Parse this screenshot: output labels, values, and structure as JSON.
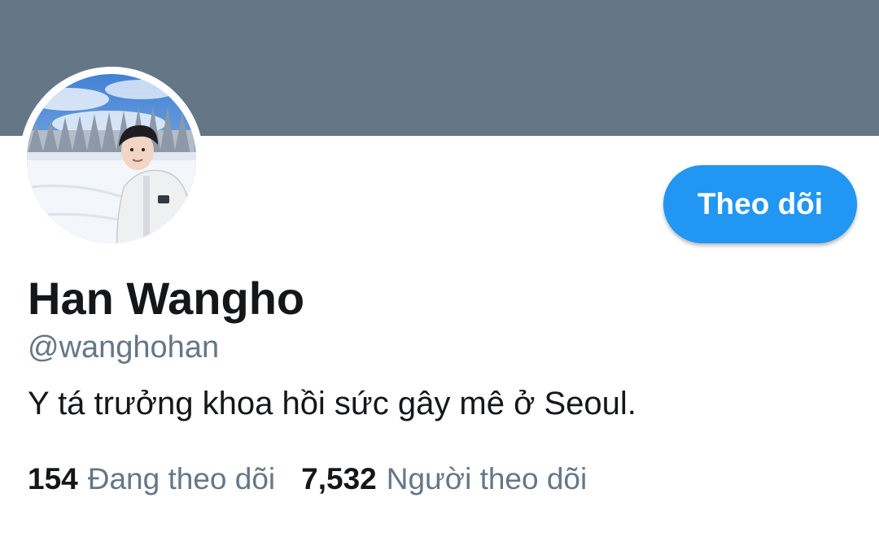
{
  "profile": {
    "display_name": "Han Wangho",
    "handle": "@wanghohan",
    "bio": "Y tá trưởng khoa hồi sức gây mê ở Seoul.",
    "follow_button_label": "Theo dõi",
    "following_count": "154",
    "following_label": "Đang theo dõi",
    "followers_count": "7,532",
    "followers_label": "Người theo dõi"
  },
  "colors": {
    "banner": "#657786",
    "accent": "#2196f3",
    "primary_text": "#14171a",
    "secondary_text": "#657786"
  }
}
